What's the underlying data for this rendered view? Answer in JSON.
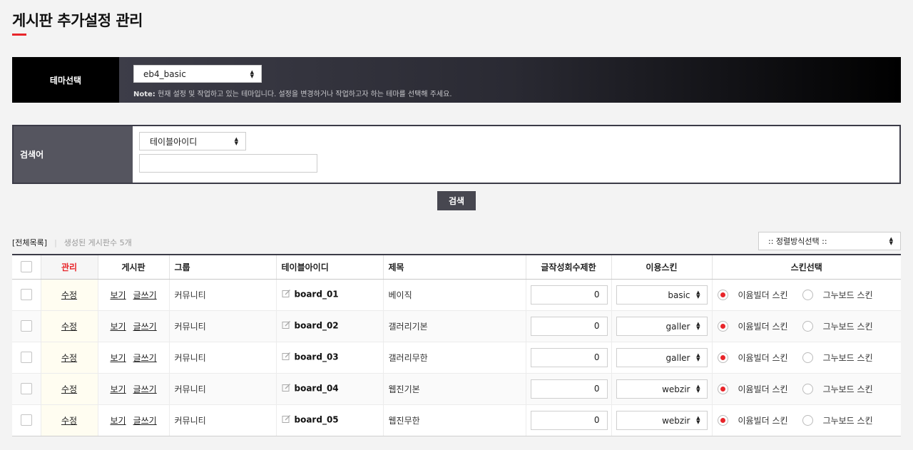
{
  "page": {
    "title": "게시판 추가설정 관리"
  },
  "colors": {
    "accent": "#e8252a",
    "dark": "#3b3b47",
    "search_label_bg": "#55555f"
  },
  "theme": {
    "label": "테마선택",
    "selected": "eb4_basic",
    "note_prefix": "Note:",
    "note_text": " 현재 설정 및 작업하고 있는 테마입니다. 설정을 변경하거나 작업하고자 하는 테마를 선택해 주세요."
  },
  "search": {
    "label": "검색어",
    "field_selected": "테이블아이디",
    "input_value": "",
    "button": "검색"
  },
  "list": {
    "total_label": "[전체목록]",
    "separator": "|",
    "count_text": "생성된 게시판수 5개",
    "sort_placeholder": ":: 정렬방식선택 ::"
  },
  "table": {
    "headers": {
      "manage": "관리",
      "board": "게시판",
      "group": "그룹",
      "table_id": "테이블아이디",
      "title": "제목",
      "limit": "글작성회수제한",
      "skin": "이용스킨",
      "skin_choice": "스킨선택"
    },
    "edit_label": "수정",
    "view_label": "보기",
    "write_label": "글쓰기",
    "radio_builder": "이윰빌더 스킨",
    "radio_gnuboard": "그누보드 스킨",
    "rows": [
      {
        "group": "커뮤니티",
        "table_id": "board_01",
        "title": "베이직",
        "limit": "0",
        "skin": "basic",
        "skin_choice": "builder"
      },
      {
        "group": "커뮤니티",
        "table_id": "board_02",
        "title": "갤러리기본",
        "limit": "0",
        "skin": "galler",
        "skin_choice": "builder"
      },
      {
        "group": "커뮤니티",
        "table_id": "board_03",
        "title": "갤러리무한",
        "limit": "0",
        "skin": "galler",
        "skin_choice": "builder"
      },
      {
        "group": "커뮤니티",
        "table_id": "board_04",
        "title": "웹진기본",
        "limit": "0",
        "skin": "webzir",
        "skin_choice": "builder"
      },
      {
        "group": "커뮤니티",
        "table_id": "board_05",
        "title": "웹진무한",
        "limit": "0",
        "skin": "webzir",
        "skin_choice": "builder"
      }
    ]
  }
}
